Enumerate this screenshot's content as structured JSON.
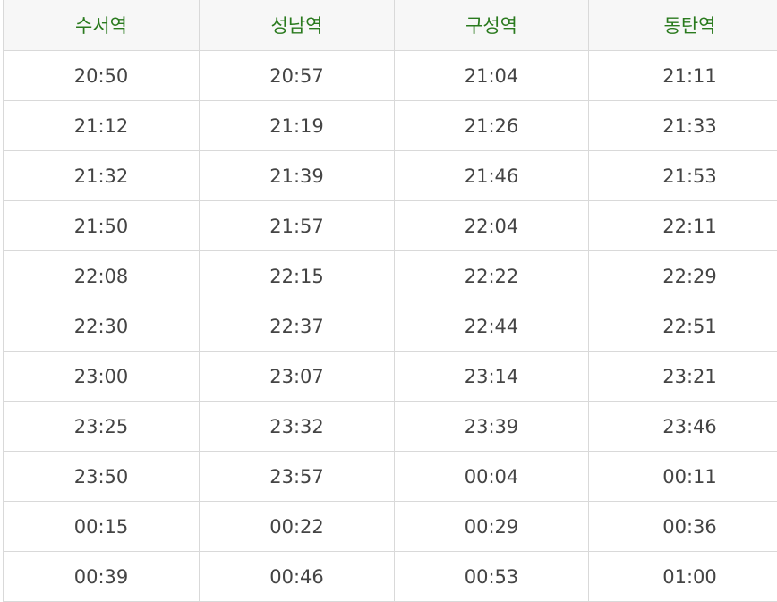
{
  "table": {
    "headers": [
      "수서역",
      "성남역",
      "구성역",
      "동탄역"
    ],
    "rows": [
      [
        "20:50",
        "20:57",
        "21:04",
        "21:11"
      ],
      [
        "21:12",
        "21:19",
        "21:26",
        "21:33"
      ],
      [
        "21:32",
        "21:39",
        "21:46",
        "21:53"
      ],
      [
        "21:50",
        "21:57",
        "22:04",
        "22:11"
      ],
      [
        "22:08",
        "22:15",
        "22:22",
        "22:29"
      ],
      [
        "22:30",
        "22:37",
        "22:44",
        "22:51"
      ],
      [
        "23:00",
        "23:07",
        "23:14",
        "23:21"
      ],
      [
        "23:25",
        "23:32",
        "23:39",
        "23:46"
      ],
      [
        "23:50",
        "23:57",
        "00:04",
        "00:11"
      ],
      [
        "00:15",
        "00:22",
        "00:29",
        "00:36"
      ],
      [
        "00:39",
        "00:46",
        "00:53",
        "01:00"
      ]
    ]
  },
  "colors": {
    "header_text": "#2a7a1e",
    "header_bg": "#f7f7f7",
    "cell_text": "#444444",
    "border": "#d9d9d9"
  }
}
